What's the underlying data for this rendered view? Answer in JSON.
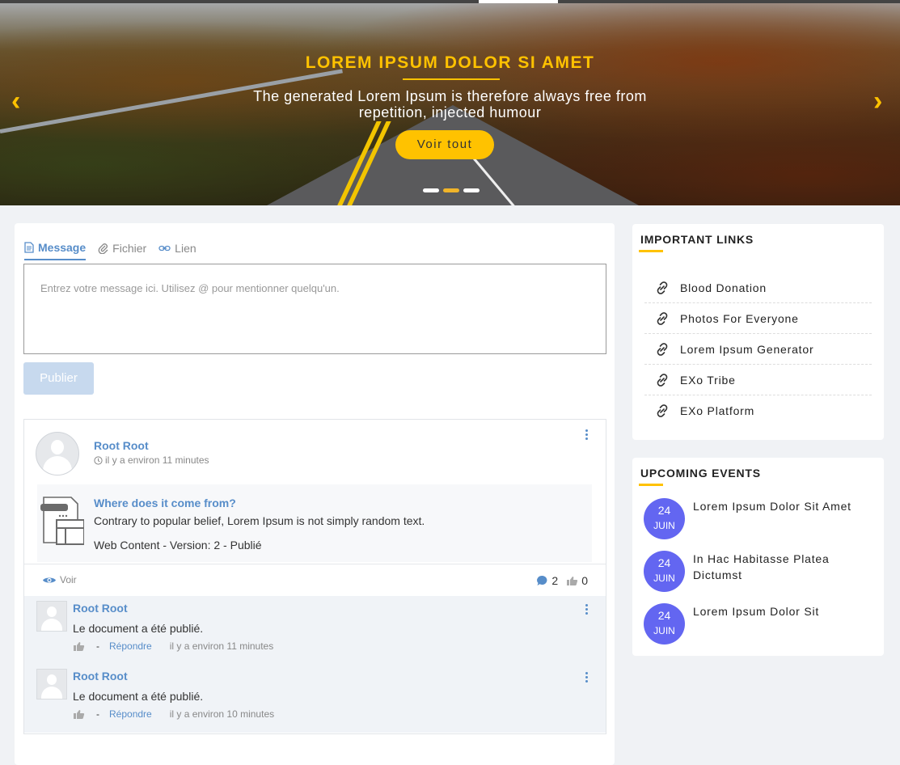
{
  "hero": {
    "title": "LOREM IPSUM DOLOR SI AMET",
    "subtitle": "The generated Lorem Ipsum is therefore always free from repetition, injected humour",
    "button_label": "Voir tout",
    "prev_arrow": "‹",
    "next_arrow": "›",
    "slide_count": 3,
    "active_slide": 2,
    "accent_color": "#ffc200"
  },
  "composer": {
    "tabs": [
      "Message",
      "Fichier",
      "Lien"
    ],
    "active_tab": "Message",
    "placeholder": "Entrez votre message ici. Utilisez @ pour mentionner quelqu'un.",
    "publish_label": "Publier"
  },
  "activity": {
    "author": "Root Root",
    "time": "il y a environ 11 minutes",
    "content_title": "Where does it come from?",
    "content_text": "Contrary to popular belief, Lorem Ipsum is not simply random text.",
    "content_meta": "Web Content - Version: 2 - Publié",
    "view_label": "Voir",
    "comment_count": "2",
    "like_count": "0",
    "link_color": "#578dc9"
  },
  "comments": [
    {
      "author": "Root Root",
      "text": "Le document a été publié.",
      "separator": "-",
      "reply_label": "Répondre",
      "time": "il y a environ 11 minutes"
    },
    {
      "author": "Root Root",
      "text": "Le document a été publié.",
      "separator": "-",
      "reply_label": "Répondre",
      "time": "il y a environ 10 minutes"
    }
  ],
  "links_panel": {
    "title": "IMPORTANT LINKS",
    "items": [
      "Blood Donation",
      "Photos For Everyone",
      "Lorem Ipsum Generator",
      "EXo Tribe",
      "EXo Platform"
    ],
    "icon": "link-icon"
  },
  "events_panel": {
    "title": "UPCOMING EVENTS",
    "badge_color": "#6366f1",
    "items": [
      {
        "day": "24",
        "month": "JUIN",
        "title": "Lorem Ipsum Dolor Sit Amet"
      },
      {
        "day": "24",
        "month": "JUIN",
        "title": "In Hac Habitasse Platea Dictumst"
      },
      {
        "day": "24",
        "month": "JUIN",
        "title": "Lorem Ipsum Dolor Sit"
      }
    ]
  }
}
